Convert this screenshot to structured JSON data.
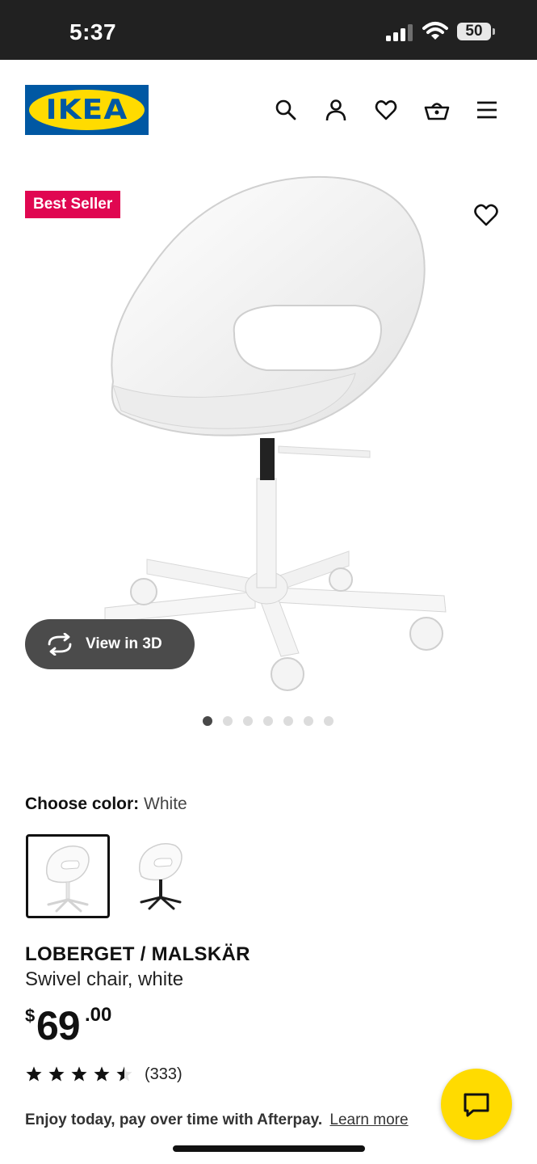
{
  "status_bar": {
    "time": "5:37",
    "battery": "50"
  },
  "header": {
    "logo_text": "IKEA",
    "icons": [
      "search-icon",
      "account-icon",
      "heart-icon",
      "basket-icon",
      "menu-icon"
    ]
  },
  "product_media": {
    "badge": "Best Seller",
    "view_3d_label": "View in 3D",
    "carousel": {
      "total": 7,
      "active": 1
    }
  },
  "color": {
    "label": "Choose color:",
    "selected": "White",
    "options": [
      "White",
      "Black"
    ]
  },
  "product": {
    "name": "LOBERGET / MALSKÄR",
    "description": "Swivel chair, white",
    "price": {
      "currency": "$",
      "integer": "69",
      "decimal": ".00"
    }
  },
  "rating": {
    "stars": 4.5,
    "max": 5,
    "count": "(333)"
  },
  "afterpay": {
    "text": "Enjoy today, pay over time with Afterpay.",
    "link": "Learn more"
  },
  "colors": {
    "brand_blue": "#0058a3",
    "brand_yellow": "#ffdb00",
    "badge_red": "#e00751"
  }
}
